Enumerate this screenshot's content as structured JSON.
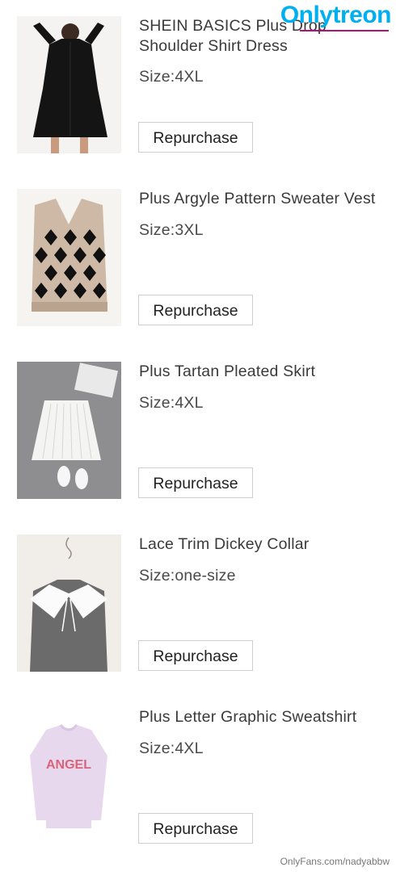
{
  "watermark": {
    "brand_a": "Only",
    "brand_b": "treon",
    "footer": "OnlyFans.com/nadyabbw"
  },
  "items": [
    {
      "title": "SHEIN BASICS Plus Drop\nShoulder Shirt Dress",
      "size": "Size:4XL",
      "button": "Repurchase",
      "image": "black-shirt-dress"
    },
    {
      "title": "Plus Argyle Pattern Sweater Vest",
      "size": "Size:3XL",
      "button": "Repurchase",
      "image": "argyle-sweater-vest"
    },
    {
      "title": "Plus Tartan Pleated Skirt",
      "size": "Size:4XL",
      "button": "Repurchase",
      "image": "white-pleated-skirt"
    },
    {
      "title": "Lace Trim Dickey Collar",
      "size": "Size:one-size",
      "button": "Repurchase",
      "image": "lace-collar"
    },
    {
      "title": "Plus Letter Graphic Sweatshirt",
      "size": "Size:4XL",
      "button": "Repurchase",
      "image": "lilac-sweatshirt"
    }
  ]
}
